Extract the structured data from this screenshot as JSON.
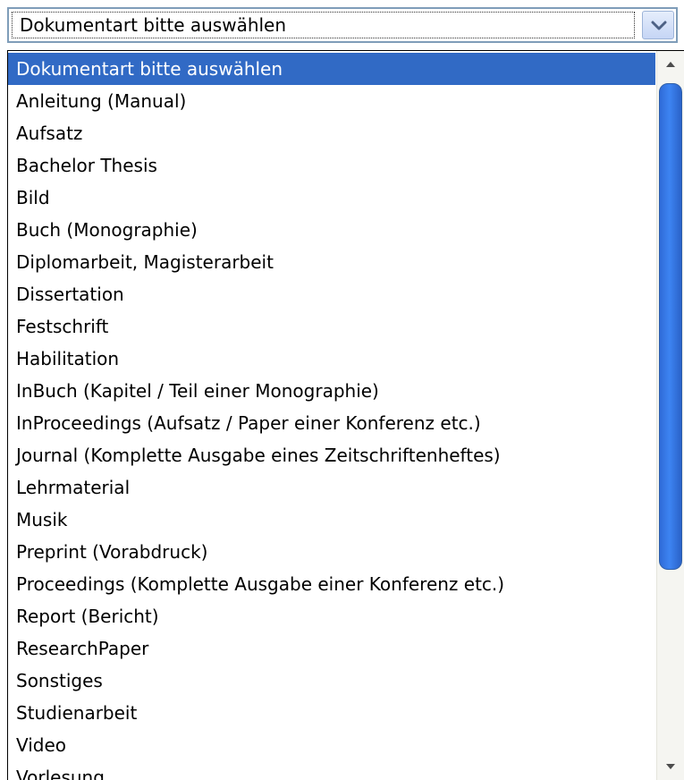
{
  "select": {
    "current_value": "Dokumentart bitte auswählen"
  },
  "icons": {
    "dropdown_arrow": "chevron-down-icon",
    "scroll_up": "triangle-up-icon",
    "scroll_down": "triangle-down-icon"
  },
  "colors": {
    "selection_highlight": "#316AC5",
    "selection_text": "#FFFFFF",
    "scroll_thumb": "#3A7BE8",
    "border": "#7F9DB9"
  },
  "options": [
    {
      "label": "Dokumentart bitte auswählen",
      "selected": true
    },
    {
      "label": "Anleitung (Manual)",
      "selected": false
    },
    {
      "label": "Aufsatz",
      "selected": false
    },
    {
      "label": "Bachelor Thesis",
      "selected": false
    },
    {
      "label": "Bild",
      "selected": false
    },
    {
      "label": "Buch (Monographie)",
      "selected": false
    },
    {
      "label": "Diplomarbeit, Magisterarbeit",
      "selected": false
    },
    {
      "label": "Dissertation",
      "selected": false
    },
    {
      "label": "Festschrift",
      "selected": false
    },
    {
      "label": "Habilitation",
      "selected": false
    },
    {
      "label": "InBuch (Kapitel / Teil einer Monographie)",
      "selected": false
    },
    {
      "label": "InProceedings (Aufsatz / Paper einer Konferenz etc.)",
      "selected": false
    },
    {
      "label": "Journal (Komplette Ausgabe eines Zeitschriftenheftes)",
      "selected": false
    },
    {
      "label": "Lehrmaterial",
      "selected": false
    },
    {
      "label": "Musik",
      "selected": false
    },
    {
      "label": "Preprint (Vorabdruck)",
      "selected": false
    },
    {
      "label": "Proceedings (Komplette Ausgabe einer Konferenz etc.)",
      "selected": false
    },
    {
      "label": "Report (Bericht)",
      "selected": false
    },
    {
      "label": "ResearchPaper",
      "selected": false
    },
    {
      "label": "Sonstiges",
      "selected": false
    },
    {
      "label": "Studienarbeit",
      "selected": false
    },
    {
      "label": "Video",
      "selected": false
    },
    {
      "label": "Vorlesung",
      "selected": false
    }
  ]
}
